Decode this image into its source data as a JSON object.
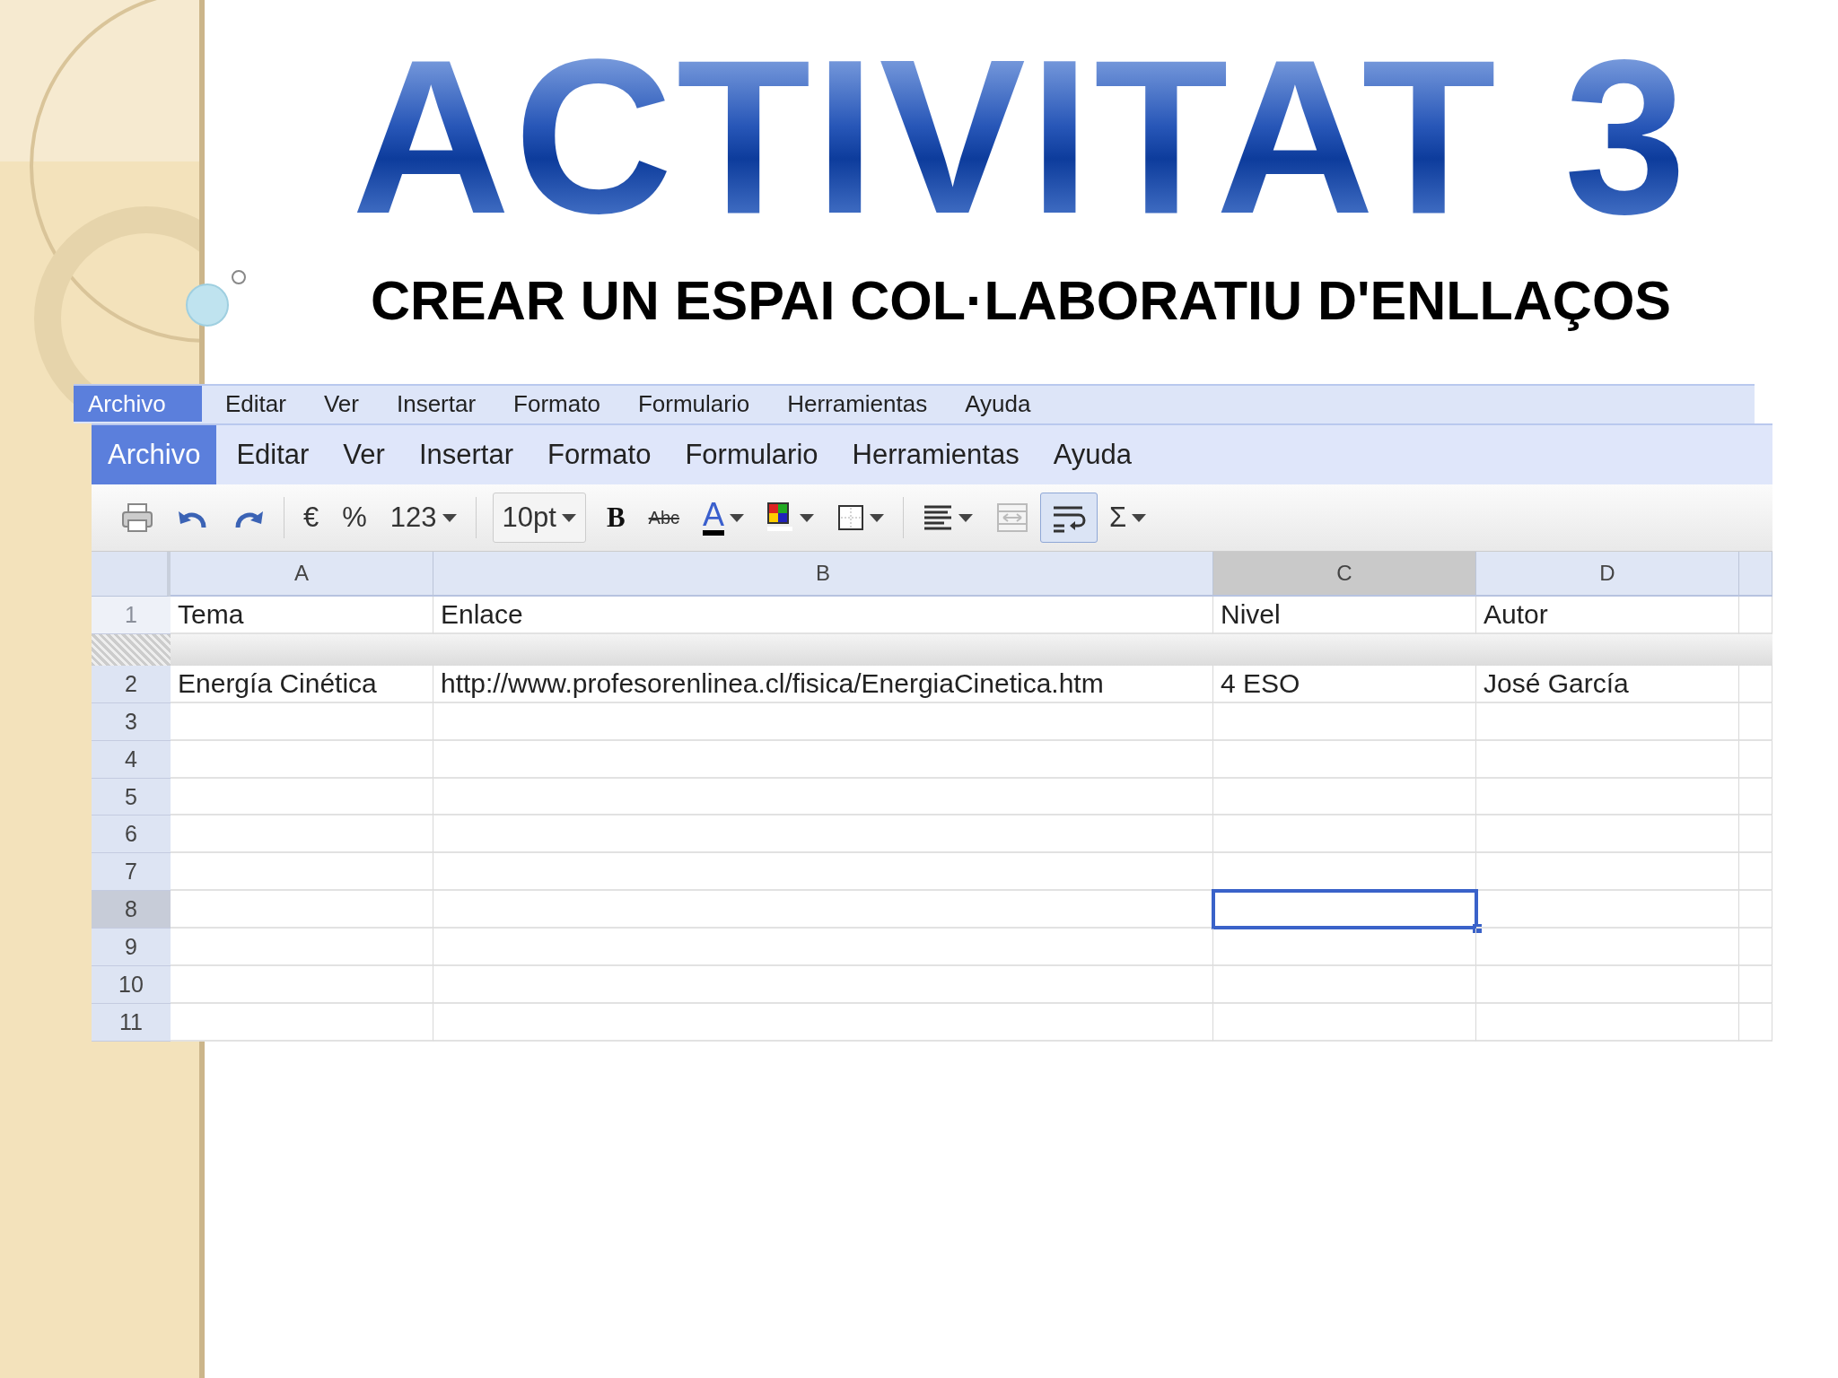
{
  "slide": {
    "title": "ACTIVITAT 3",
    "subtitle": "CREAR UN ESPAI COL·LABORATIU D'ENLLAÇOS"
  },
  "back_menu": {
    "items": [
      {
        "label": "Archivo",
        "selected": true
      },
      {
        "label": "Editar",
        "selected": false
      },
      {
        "label": "Ver",
        "selected": false
      },
      {
        "label": "Insertar",
        "selected": false
      },
      {
        "label": "Formato",
        "selected": false
      },
      {
        "label": "Formulario",
        "selected": false
      },
      {
        "label": "Herramientas",
        "selected": false
      },
      {
        "label": "Ayuda",
        "selected": false
      }
    ]
  },
  "menu": {
    "items": [
      {
        "label": "Archivo",
        "selected": true
      },
      {
        "label": "Editar",
        "selected": false
      },
      {
        "label": "Ver",
        "selected": false
      },
      {
        "label": "Insertar",
        "selected": false
      },
      {
        "label": "Formato",
        "selected": false
      },
      {
        "label": "Formulario",
        "selected": false
      },
      {
        "label": "Herramientas",
        "selected": false
      },
      {
        "label": "Ayuda",
        "selected": false
      }
    ]
  },
  "toolbar": [
    {
      "kind": "print",
      "pressed": false,
      "dropdown": false
    },
    {
      "kind": "undo",
      "pressed": false,
      "dropdown": false
    },
    {
      "kind": "redo",
      "pressed": false,
      "dropdown": false
    },
    {
      "kind": "separator"
    },
    {
      "kind": "text",
      "label": "€",
      "pressed": false,
      "dropdown": false
    },
    {
      "kind": "text",
      "label": "%",
      "pressed": false,
      "dropdown": false
    },
    {
      "kind": "text",
      "label": "123",
      "pressed": false,
      "dropdown": true
    },
    {
      "kind": "separator"
    },
    {
      "kind": "select",
      "label": "10pt",
      "pressed": false,
      "dropdown": true
    },
    {
      "kind": "bold",
      "label": "B",
      "pressed": false,
      "dropdown": false
    },
    {
      "kind": "strike",
      "label": "Abc",
      "pressed": false,
      "dropdown": false
    },
    {
      "kind": "text-color",
      "label": "A",
      "pressed": false,
      "dropdown": true
    },
    {
      "kind": "fill-color",
      "pressed": false,
      "dropdown": true
    },
    {
      "kind": "borders",
      "pressed": false,
      "dropdown": true
    },
    {
      "kind": "separator"
    },
    {
      "kind": "align",
      "pressed": false,
      "dropdown": true
    },
    {
      "kind": "merge",
      "pressed": false,
      "dropdown": false
    },
    {
      "kind": "wrap",
      "pressed": true,
      "dropdown": false
    },
    {
      "kind": "text",
      "label": "Σ",
      "pressed": false,
      "dropdown": true
    }
  ],
  "grid": {
    "columns": [
      {
        "label": "A",
        "selected": false
      },
      {
        "label": "B",
        "selected": false
      },
      {
        "label": "C",
        "selected": true
      },
      {
        "label": "D",
        "selected": false
      }
    ],
    "rows": [
      {
        "number": "1",
        "selected": false,
        "frozen": true,
        "cells": [
          "Tema",
          "Enlace",
          "Nivel",
          "Autor"
        ]
      },
      {
        "number": "2",
        "selected": false,
        "frozen": false,
        "cells": [
          "Energía Cinética",
          "http://www.profesorenlinea.cl/fisica/EnergiaCinetica.htm",
          "4 ESO",
          "José García"
        ]
      },
      {
        "number": "3",
        "selected": false,
        "frozen": false
      },
      {
        "number": "4",
        "selected": false,
        "frozen": false
      },
      {
        "number": "5",
        "selected": false,
        "frozen": false
      },
      {
        "number": "6",
        "selected": false,
        "frozen": false
      },
      {
        "number": "7",
        "selected": false,
        "frozen": false
      },
      {
        "number": "8",
        "selected": true,
        "frozen": false
      },
      {
        "number": "9",
        "selected": false,
        "frozen": false
      },
      {
        "number": "10",
        "selected": false,
        "frozen": false
      },
      {
        "number": "11",
        "selected": false,
        "frozen": false
      }
    ]
  }
}
